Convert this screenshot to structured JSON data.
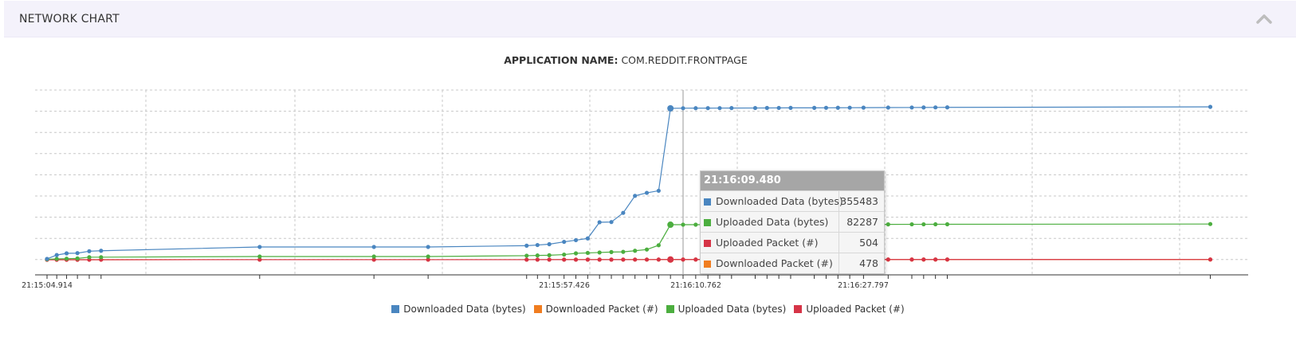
{
  "panel": {
    "title": "NETWORK CHART"
  },
  "chart_data": {
    "type": "line",
    "title_label": "APPLICATION NAME:",
    "title_value": "COM.REDDIT.FRONTPAGE",
    "xlabel": "",
    "ylabel": "",
    "grid": true,
    "legend_position": "bottom",
    "x_tick_labels": [
      "21:15:04.914",
      "21:15:57.426",
      "21:16:10.762",
      "21:16:27.797"
    ],
    "x": [
      "21:15:04.914",
      "21:15:05.9",
      "21:15:06.9",
      "21:15:08.0",
      "21:15:09.2",
      "21:15:10.4",
      "21:15:26.5",
      "21:15:38.1",
      "21:15:43.6",
      "21:15:53.6",
      "21:15:54.7",
      "21:15:55.9",
      "21:15:57.4",
      "21:15:58.6",
      "21:15:59.8",
      "21:16:01.0",
      "21:16:02.2",
      "21:16:03.4",
      "21:16:04.6",
      "21:16:05.8",
      "21:16:07.0",
      "21:16:08.2",
      "21:16:09.480",
      "21:16:10.762",
      "21:16:12.0",
      "21:16:13.2",
      "21:16:14.4",
      "21:16:16.8",
      "21:16:18.0",
      "21:16:19.2",
      "21:16:20.4",
      "21:16:22.8",
      "21:16:24.0",
      "21:16:25.2",
      "21:16:26.4",
      "21:16:27.797",
      "21:16:30.3",
      "21:16:32.7",
      "21:16:33.9",
      "21:16:35.1",
      "21:16:36.3",
      "21:16:63.0"
    ],
    "series": [
      {
        "name": "Downloaded Data (bytes)",
        "color": "#4a86c0",
        "values": [
          2000,
          11000,
          15000,
          15500,
          20000,
          21000,
          30000,
          30000,
          30000,
          33000,
          34500,
          36500,
          42000,
          46000,
          50000,
          88000,
          88500,
          110000,
          150000,
          157000,
          162000,
          355483,
          355800,
          355900,
          356000,
          356100,
          356200,
          356300,
          356400,
          356500,
          356600,
          356700,
          356800,
          356900,
          357000,
          357100,
          357300,
          357500,
          357600,
          357700,
          357800,
          359000
        ]
      },
      {
        "name": "Uploaded Data (bytes)",
        "color": "#4cae3f",
        "values": [
          1000,
          2000,
          2500,
          3000,
          6000,
          6000,
          7500,
          7500,
          7500,
          9500,
          10000,
          10500,
          12000,
          15000,
          16000,
          17000,
          18000,
          18500,
          21000,
          24000,
          34000,
          82287,
          82300,
          82350,
          82400,
          82450,
          82500,
          82550,
          82600,
          82650,
          82700,
          82750,
          82800,
          82850,
          82900,
          82950,
          83000,
          83100,
          83150,
          83200,
          83250,
          83800
        ]
      },
      {
        "name": "Uploaded Packet (#)",
        "color": "#d63447",
        "values": [
          10,
          20,
          30,
          40,
          60,
          70,
          100,
          120,
          130,
          160,
          170,
          180,
          200,
          220,
          240,
          260,
          280,
          300,
          330,
          360,
          400,
          504,
          505,
          506,
          507,
          508,
          509,
          510,
          511,
          512,
          513,
          514,
          515,
          516,
          517,
          518,
          520,
          522,
          523,
          524,
          525,
          540
        ]
      },
      {
        "name": "Downloaded Packet (#)",
        "color": "#f07d20",
        "values": [
          8,
          15,
          25,
          35,
          50,
          60,
          90,
          100,
          110,
          140,
          150,
          160,
          180,
          200,
          220,
          240,
          260,
          280,
          310,
          340,
          380,
          478,
          479,
          480,
          481,
          482,
          483,
          484,
          485,
          486,
          487,
          488,
          489,
          490,
          491,
          492,
          494,
          496,
          497,
          498,
          499,
          510
        ]
      }
    ],
    "legend": [
      {
        "name": "Downloaded Data (bytes)",
        "color": "#4a86c0"
      },
      {
        "name": "Downloaded Packet (#)",
        "color": "#f07d20"
      },
      {
        "name": "Uploaded Data (bytes)",
        "color": "#4cae3f"
      },
      {
        "name": "Uploaded Packet (#)",
        "color": "#d63447"
      }
    ],
    "tooltip": {
      "time": "21:16:09.480",
      "rows": [
        {
          "name": "Downloaded Data (bytes)",
          "value": "355483",
          "color": "#4a86c0"
        },
        {
          "name": "Uploaded Data (bytes)",
          "value": "82287",
          "color": "#4cae3f"
        },
        {
          "name": "Uploaded Packet (#)",
          "value": "504",
          "color": "#d63447"
        },
        {
          "name": "Downloaded Packet (#)",
          "value": "478",
          "color": "#f07d20"
        }
      ]
    }
  }
}
